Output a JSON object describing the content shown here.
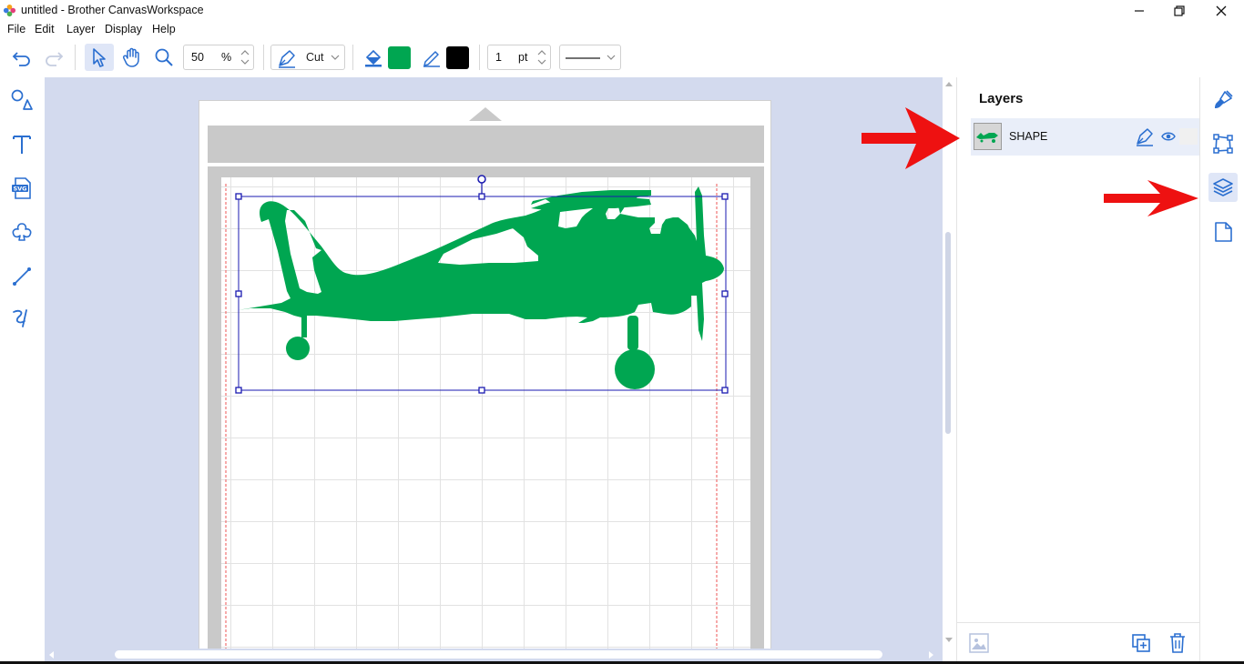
{
  "window": {
    "title": "untitled - Brother CanvasWorkspace"
  },
  "menu": {
    "items": [
      "File",
      "Edit",
      "Layer",
      "Display",
      "Help"
    ]
  },
  "toolbar": {
    "zoom_value": "50",
    "zoom_unit": "%",
    "mode_label": "Cut",
    "fill_color": "#00a651",
    "line_color": "#000000",
    "line_width_value": "1",
    "line_width_unit": "pt",
    "accent": "#1f5fbf"
  },
  "left_tools": [
    "shapes-icon",
    "text-icon",
    "svg-import-icon",
    "outline-shape-icon",
    "line-icon",
    "freehand-icon"
  ],
  "canvas": {
    "shape_name": "airplane-silhouette",
    "shape_color": "#00a651",
    "selection_color": "#1a1ab0"
  },
  "layers_panel": {
    "title": "Layers",
    "layers": [
      {
        "name": "SHAPE"
      }
    ]
  },
  "right_tools": [
    "paint-brush-icon",
    "transform-icon",
    "layers-icon",
    "page-icon"
  ],
  "annotations": {
    "arrow_color": "#ee1111"
  }
}
